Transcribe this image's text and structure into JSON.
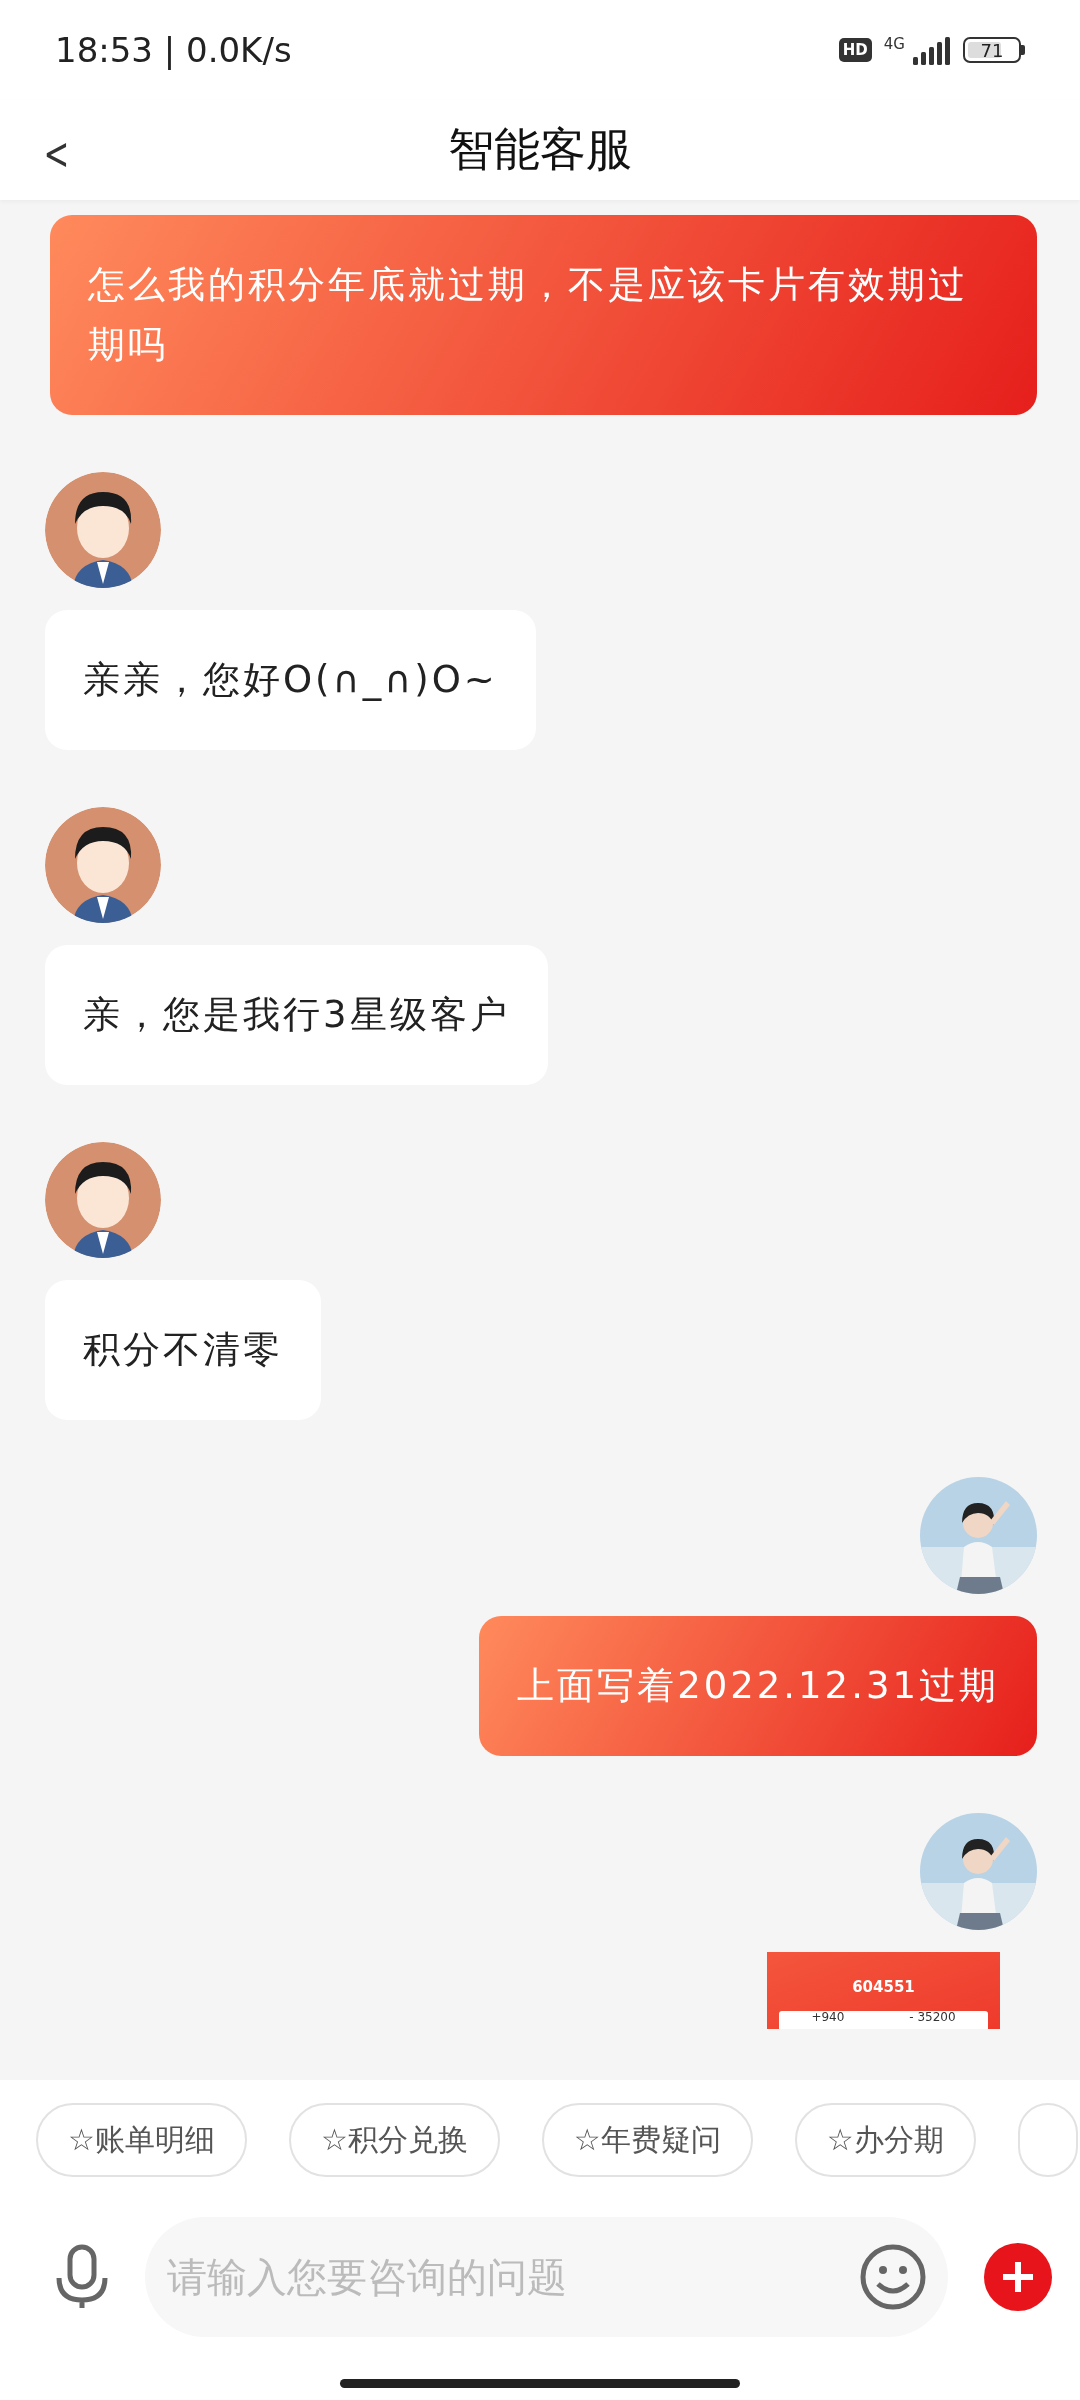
{
  "status_bar": {
    "time": "18:53 | 0.0K/s",
    "hd": "HD",
    "network": "4G",
    "battery": "71"
  },
  "header": {
    "back": "<",
    "title": "智能客服"
  },
  "messages": [
    {
      "kind": "sent",
      "avatar": false,
      "text": "怎么我的积分年底就过期，不是应该卡片有效期过期吗"
    },
    {
      "kind": "received",
      "avatar": true,
      "text": "亲亲，您好O(∩_∩)O~"
    },
    {
      "kind": "received",
      "avatar": true,
      "text": "亲，您是我行3星级客户"
    },
    {
      "kind": "received",
      "avatar": true,
      "text": "积分不清零"
    },
    {
      "kind": "sent",
      "avatar": true,
      "text": "上面写着2022.12.31过期"
    },
    {
      "kind": "photo",
      "avatar": true,
      "image": {
        "points": "604551",
        "income": "+940",
        "spent": "- 35200"
      }
    }
  ],
  "quick_replies": [
    "☆账单明细",
    "☆积分兑换",
    "☆年费疑问",
    "☆办分期"
  ],
  "input": {
    "placeholder": "请输入您要咨询的问题"
  }
}
